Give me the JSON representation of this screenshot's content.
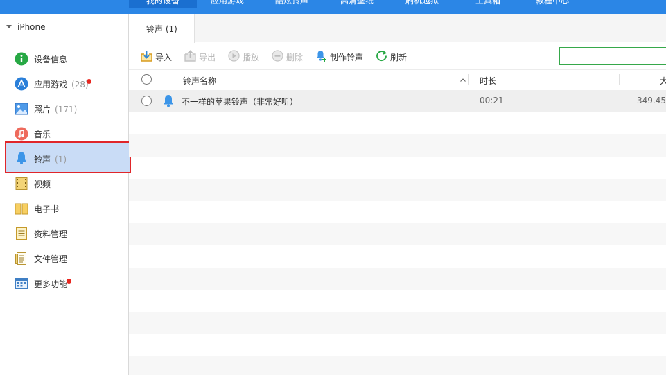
{
  "topnav": {
    "tabs": [
      {
        "label": "我的设备",
        "active": true
      },
      {
        "label": "应用游戏",
        "active": false
      },
      {
        "label": "酷炫铃声",
        "active": false
      },
      {
        "label": "高清壁纸",
        "active": false
      },
      {
        "label": "刷机越狱",
        "active": false
      },
      {
        "label": "工具箱",
        "active": false
      },
      {
        "label": "教程中心",
        "active": false
      }
    ]
  },
  "sidebar": {
    "device_name": "iPhone",
    "items": [
      {
        "label": "设备信息",
        "count": "",
        "badge": false,
        "icon": "info-icon"
      },
      {
        "label": "应用游戏",
        "count": "(28)",
        "badge": true,
        "icon": "app-store-icon"
      },
      {
        "label": "照片",
        "count": "(171)",
        "badge": false,
        "icon": "photo-icon"
      },
      {
        "label": "音乐",
        "count": "",
        "badge": false,
        "icon": "music-icon"
      },
      {
        "label": "铃声",
        "count": "(1)",
        "badge": false,
        "icon": "bell-icon",
        "selected": true
      },
      {
        "label": "视频",
        "count": "",
        "badge": false,
        "icon": "video-icon"
      },
      {
        "label": "电子书",
        "count": "",
        "badge": false,
        "icon": "book-icon"
      },
      {
        "label": "资料管理",
        "count": "",
        "badge": false,
        "icon": "contacts-icon"
      },
      {
        "label": "文件管理",
        "count": "",
        "badge": false,
        "icon": "file-icon"
      },
      {
        "label": "更多功能",
        "count": "",
        "badge": true,
        "icon": "more-icon"
      }
    ]
  },
  "main": {
    "tab_label": "铃声 (1)",
    "toolbar": {
      "import": "导入",
      "export": "导出",
      "play": "播放",
      "delete": "删除",
      "make_ringtone": "制作铃声",
      "refresh": "刷新"
    },
    "table": {
      "columns": [
        "铃声名称",
        "时长",
        "大"
      ],
      "rows": [
        {
          "name": "不一样的苹果铃声（非常好听）",
          "duration": "00:21",
          "size": "349.45"
        }
      ]
    }
  },
  "colors": {
    "accent": "#2b86e6",
    "selection_border": "#e0262a",
    "badge": "#e8261f",
    "search_border": "#36a84a"
  }
}
